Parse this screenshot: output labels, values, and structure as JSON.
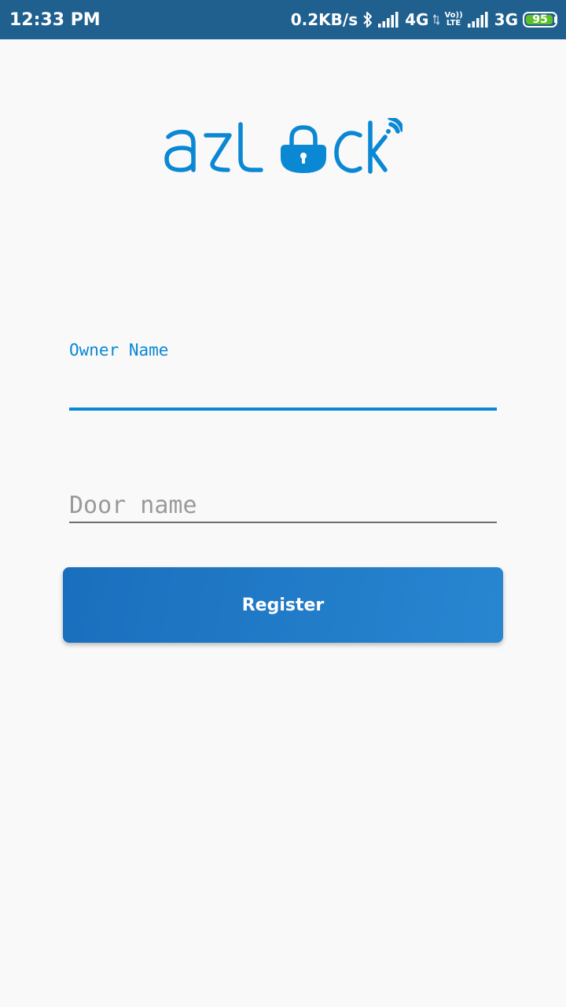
{
  "status_bar": {
    "time": "12:33 PM",
    "net_speed": "0.2KB/s",
    "network_1": "4G",
    "volte_top": "Vo))",
    "volte_bottom": "LTE",
    "network_2": "3G",
    "battery_level": "95",
    "battery_fraction": 0.95,
    "icons": [
      "bluetooth-icon",
      "signal-icon",
      "data-arrows-icon",
      "volte-icon",
      "signal-icon",
      "battery-icon"
    ]
  },
  "logo": {
    "text": "azlock",
    "color": "#0a88d3"
  },
  "form": {
    "owner_label": "Owner Name",
    "owner_value": "",
    "door_placeholder": "Door name",
    "door_value": ""
  },
  "actions": {
    "register_label": "Register"
  },
  "colors": {
    "status_bar": "#1f608f",
    "accent": "#0a88d3",
    "button": "#1f7cc7",
    "background": "#f9f9f9"
  }
}
